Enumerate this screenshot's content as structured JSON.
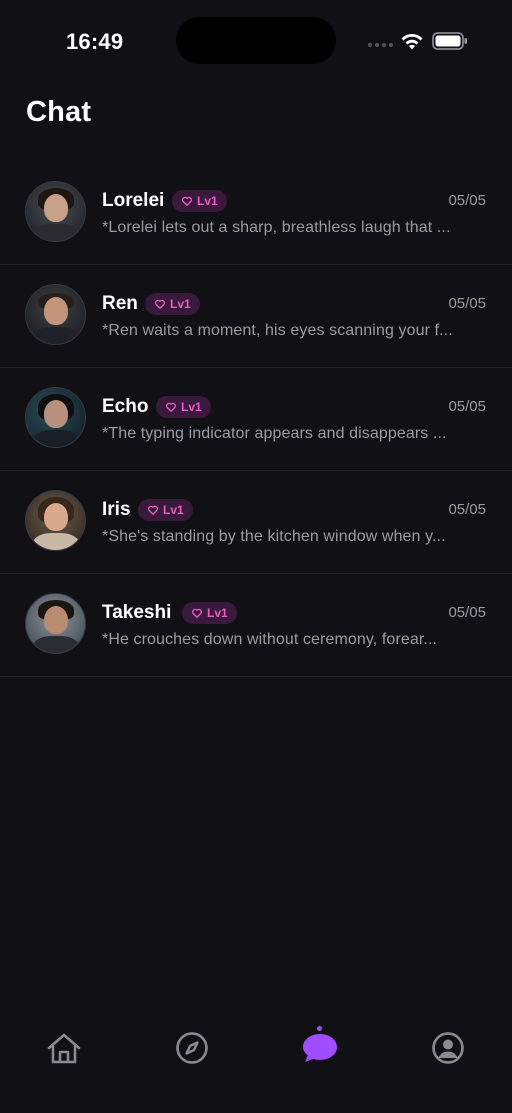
{
  "status_bar": {
    "time": "16:49"
  },
  "header": {
    "title": "Chat"
  },
  "chats": [
    {
      "name": "Lorelei",
      "level": "Lv1",
      "date": "05/05",
      "preview": "*Lorelei lets out a sharp, breathless laugh that ..."
    },
    {
      "name": "Ren",
      "level": "Lv1",
      "date": "05/05",
      "preview": "*Ren waits a moment, his eyes scanning your f..."
    },
    {
      "name": "Echo",
      "level": "Lv1",
      "date": "05/05",
      "preview": "*The typing indicator appears and disappears ..."
    },
    {
      "name": "Iris",
      "level": "Lv1",
      "date": "05/05",
      "preview": "*She's standing by the kitchen window when y..."
    },
    {
      "name": "Takeshi",
      "level": "Lv1",
      "date": "05/05",
      "preview": "*He crouches down without ceremony, forear..."
    }
  ],
  "tab_bar": {
    "tabs": [
      {
        "icon": "home-icon",
        "active": false
      },
      {
        "icon": "compass-icon",
        "active": false
      },
      {
        "icon": "chat-bubble-icon",
        "active": true
      },
      {
        "icon": "profile-icon",
        "active": false
      }
    ]
  },
  "colors": {
    "background": "#111014",
    "accent": "#a04dff",
    "badge_text": "#ea5ec4",
    "badge_bg": "#3a1a3c",
    "secondary_text": "#9c9aa4",
    "inactive_icon": "#8b8a93"
  }
}
